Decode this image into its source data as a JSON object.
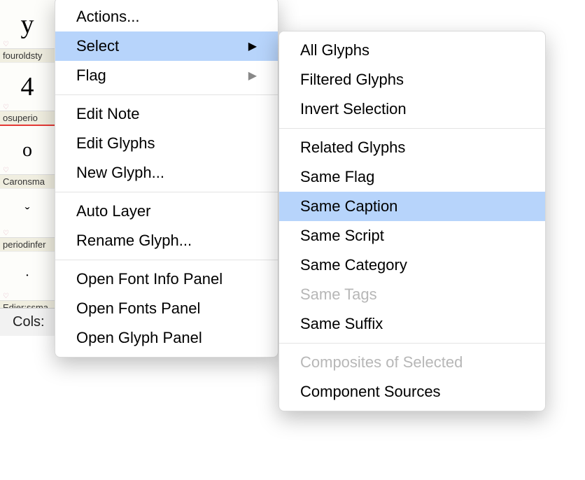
{
  "glyphs": [
    {
      "char": "y",
      "label": "fouroldsty",
      "redline": false
    },
    {
      "char": "4",
      "label": "osuperio",
      "redline": true
    },
    {
      "char": "o",
      "label": "Caronsma",
      "redline": false
    },
    {
      "char": "ˇ",
      "label": "periodinfer",
      "redline": false
    },
    {
      "char": "·",
      "label": "Edier:ssma",
      "redline": false
    }
  ],
  "cols_label": "Cols:",
  "menu_main": {
    "actions": "Actions...",
    "select": "Select",
    "flag": "Flag",
    "edit_note": "Edit Note",
    "edit_glyphs": "Edit Glyphs",
    "new_glyph": "New Glyph...",
    "auto_layer": "Auto Layer",
    "rename_glyph": "Rename Glyph...",
    "open_font_info": "Open Font Info Panel",
    "open_fonts_panel": "Open Fonts Panel",
    "open_glyph_panel": "Open Glyph Panel"
  },
  "menu_sub": {
    "all_glyphs": "All Glyphs",
    "filtered_glyphs": "Filtered Glyphs",
    "invert_selection": "Invert Selection",
    "related_glyphs": "Related Glyphs",
    "same_flag": "Same Flag",
    "same_caption": "Same Caption",
    "same_script": "Same Script",
    "same_category": "Same Category",
    "same_tags": "Same Tags",
    "same_suffix": "Same Suffix",
    "composites_selected": "Composites of Selected",
    "component_sources": "Component Sources"
  }
}
